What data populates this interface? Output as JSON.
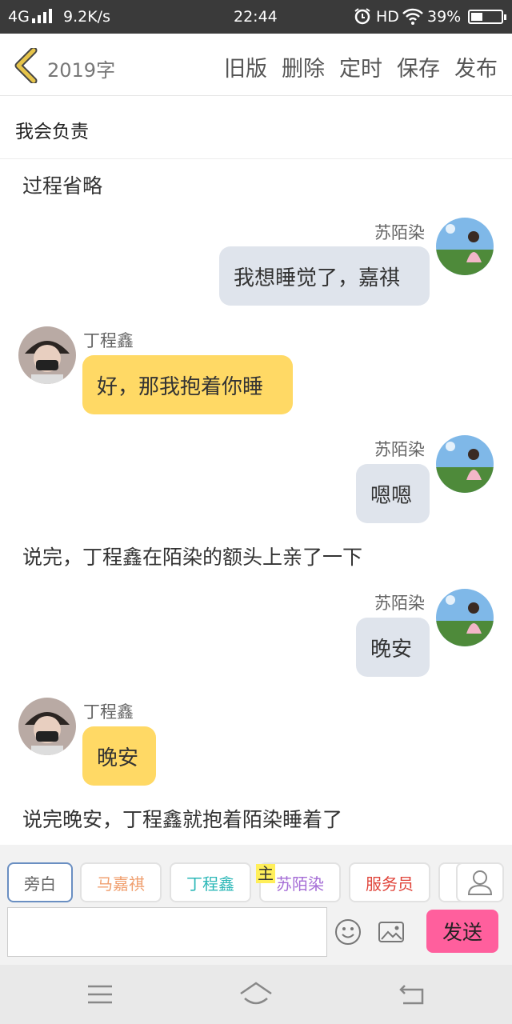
{
  "status_bar": {
    "network": "4G",
    "speed": "9.2K/s",
    "time": "22:44",
    "hd": "HD",
    "battery": "39%",
    "battery_level": 0.39
  },
  "nav": {
    "word_count": "2019字",
    "actions": [
      "旧版",
      "删除",
      "定时",
      "保存",
      "发布"
    ]
  },
  "title": "我会负责",
  "messages": [
    {
      "type": "narration",
      "text": "过程省略"
    },
    {
      "type": "right",
      "name": "苏陌染",
      "text": "我想睡觉了，嘉祺"
    },
    {
      "type": "left",
      "name": "丁程鑫",
      "text": "好，那我抱着你睡"
    },
    {
      "type": "right",
      "name": "苏陌染",
      "text": "嗯嗯"
    },
    {
      "type": "narration",
      "text": "说完，丁程鑫在陌染的额头上亲了一下"
    },
    {
      "type": "right",
      "name": "苏陌染",
      "text": "晚安"
    },
    {
      "type": "left",
      "name": "丁程鑫",
      "text": "晚安"
    },
    {
      "type": "narration",
      "text": "说完晚安，丁程鑫就抱着陌染睡着了"
    }
  ],
  "roles": [
    {
      "label": "旁白",
      "color": "#666666"
    },
    {
      "label": "马嘉祺",
      "color": "#f0a070"
    },
    {
      "label": "丁程鑫",
      "color": "#2cb7b7"
    },
    {
      "label": "苏陌染",
      "color": "#a56dd6"
    },
    {
      "label": "服务员",
      "color": "#e0443a"
    }
  ],
  "host_tag": "主",
  "input": {
    "value": "",
    "send_label": "发送"
  },
  "colors": {
    "bubble_right": "#dfe4ec",
    "bubble_left": "#ffd965",
    "send": "#ff5f9d",
    "back_arrow": "#e6c44a"
  }
}
